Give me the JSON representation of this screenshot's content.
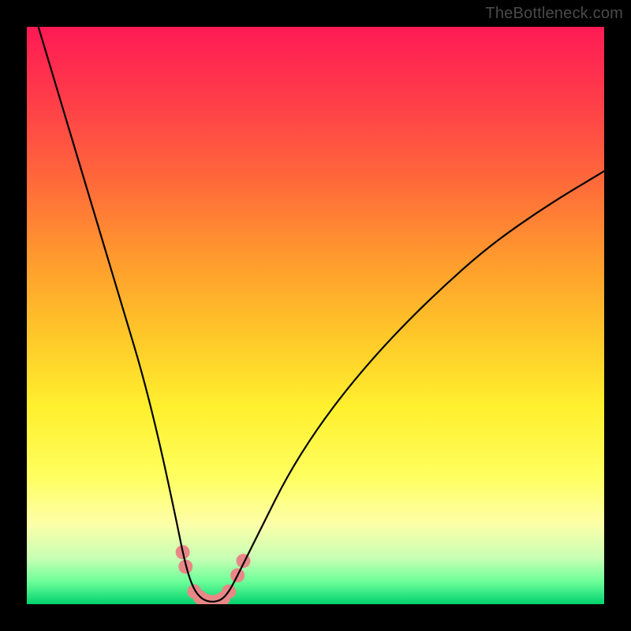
{
  "watermark": "TheBottleneck.com",
  "colors": {
    "frame": "#000000",
    "gradient_top": "#ff1a55",
    "gradient_bottom": "#02d36e",
    "curve": "#000000",
    "marker": "#e98787"
  },
  "chart_data": {
    "type": "line",
    "title": "",
    "xlabel": "",
    "ylabel": "",
    "xlim": [
      0,
      100
    ],
    "ylim": [
      0,
      100
    ],
    "grid": false,
    "legend": false,
    "series": [
      {
        "name": "bottleneck-curve",
        "x": [
          2,
          5,
          8,
          11,
          14,
          17,
          20,
          23,
          26,
          27,
          28,
          29,
          30,
          31,
          32,
          33,
          34,
          35,
          36,
          38,
          41,
          45,
          50,
          56,
          63,
          71,
          80,
          90,
          100
        ],
        "y": [
          100,
          90,
          80,
          70,
          60,
          50,
          40,
          28,
          14,
          9,
          5,
          2.5,
          1.2,
          0.6,
          0.4,
          0.5,
          1,
          2.2,
          4,
          8,
          14,
          22,
          30,
          38,
          46,
          54,
          62,
          69,
          75
        ]
      }
    ],
    "markers": [
      {
        "x": 27.0,
        "y": 9.0
      },
      {
        "x": 27.5,
        "y": 6.5
      },
      {
        "x": 29.0,
        "y": 2.2
      },
      {
        "x": 30.0,
        "y": 1.2
      },
      {
        "x": 31.0,
        "y": 0.6
      },
      {
        "x": 32.0,
        "y": 0.4
      },
      {
        "x": 33.0,
        "y": 0.5
      },
      {
        "x": 34.0,
        "y": 1.0
      },
      {
        "x": 35.0,
        "y": 2.2
      },
      {
        "x": 36.5,
        "y": 5.0
      },
      {
        "x": 37.5,
        "y": 7.5
      }
    ],
    "marker_radius": 9
  }
}
